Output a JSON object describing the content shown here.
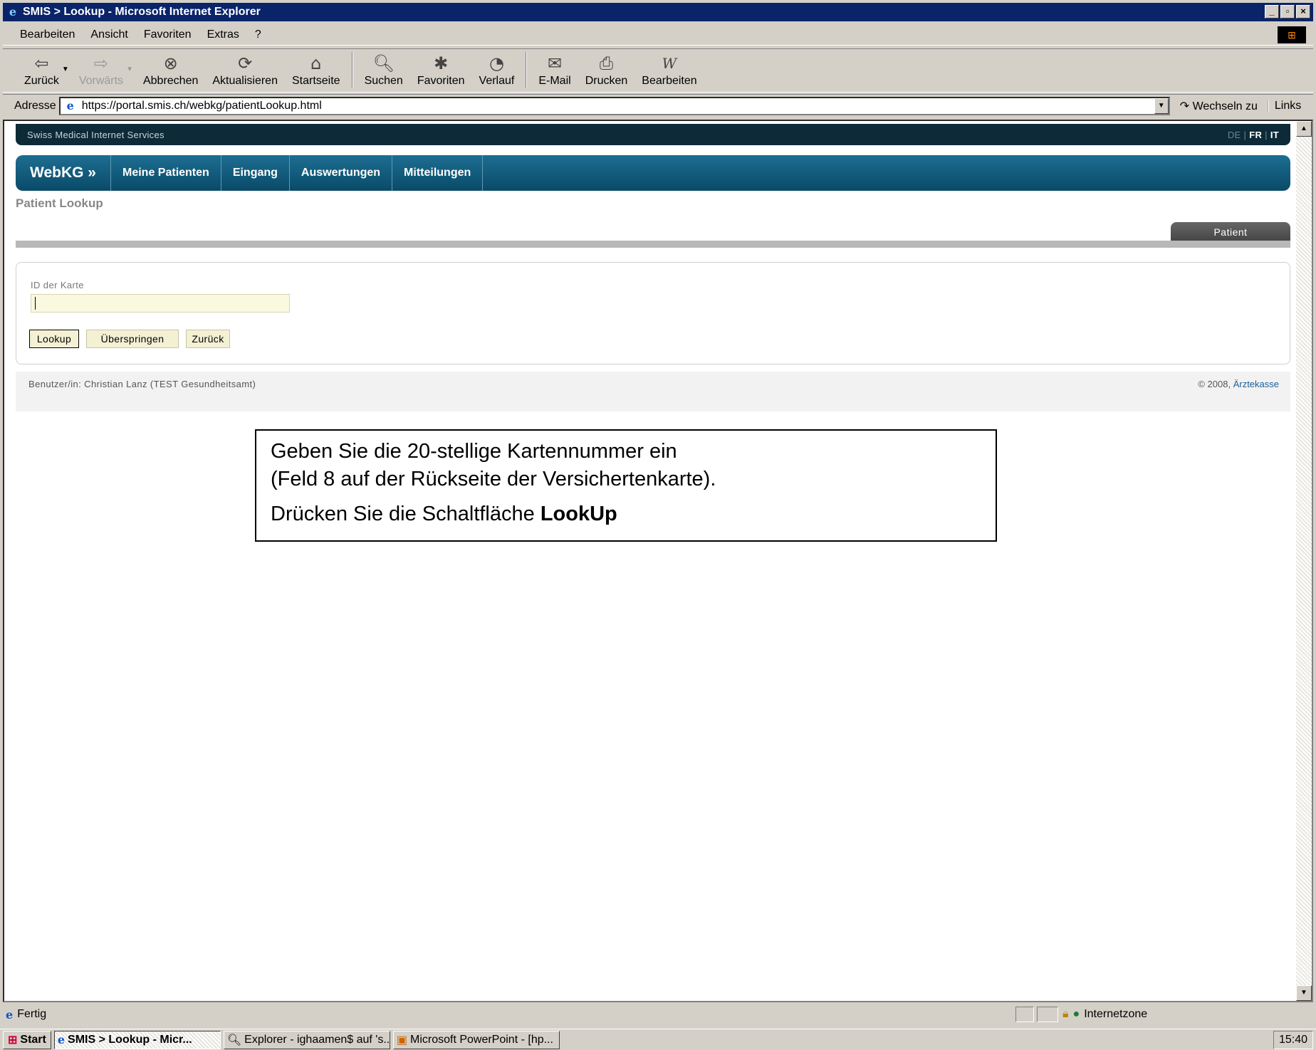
{
  "window": {
    "title": "SMIS > Lookup - Microsoft Internet Explorer",
    "minimize": "_",
    "maximize": "▫",
    "close": "×"
  },
  "menu": {
    "items": [
      "Bearbeiten",
      "Ansicht",
      "Favoriten",
      "Extras",
      "?"
    ]
  },
  "toolbar": {
    "back": "Zurück",
    "forward": "Vorwärts",
    "stop": "Abbrechen",
    "refresh": "Aktualisieren",
    "home": "Startseite",
    "search": "Suchen",
    "favorites": "Favoriten",
    "history": "Verlauf",
    "mail": "E-Mail",
    "print": "Drucken",
    "edit": "Bearbeiten"
  },
  "address": {
    "label": "Adresse",
    "url": "https://portal.smis.ch/webkg/patientLookup.html",
    "go": "Wechseln zu",
    "links": "Links"
  },
  "site": {
    "name": "Swiss Medical Internet Services",
    "lang_de": "DE",
    "lang_fr": "FR",
    "lang_it": "IT",
    "sep": "|"
  },
  "nav": {
    "brand": "WebKG »",
    "items": [
      "Meine Patienten",
      "Eingang",
      "Auswertungen",
      "Mitteilungen"
    ]
  },
  "page": {
    "title": "Patient Lookup",
    "tab": "Patient"
  },
  "form": {
    "card_label": "ID der Karte",
    "card_value": "",
    "lookup": "Lookup",
    "skip": "Überspringen",
    "back": "Zurück"
  },
  "footer": {
    "user": "Benutzer/in: Christian Lanz (TEST Gesundheitsamt)",
    "copyright": "© 2008,",
    "company": "Ärztekasse"
  },
  "note": {
    "line1": "Geben Sie die 20-stellige Kartennummer ein",
    "line2": "(Feld 8 auf der Rückseite der Versichertenkarte).",
    "line3_prefix": "Drücken Sie die Schaltfläche ",
    "line3_bold": "LookUp"
  },
  "status": {
    "text": "Fertig",
    "zone": "Internetzone"
  },
  "taskbar": {
    "start": "Start",
    "tasks": [
      "SMIS > Lookup - Micr...",
      "Explorer - ighaamen$ auf 's...",
      "Microsoft PowerPoint - [hp..."
    ],
    "clock": "15:40"
  }
}
